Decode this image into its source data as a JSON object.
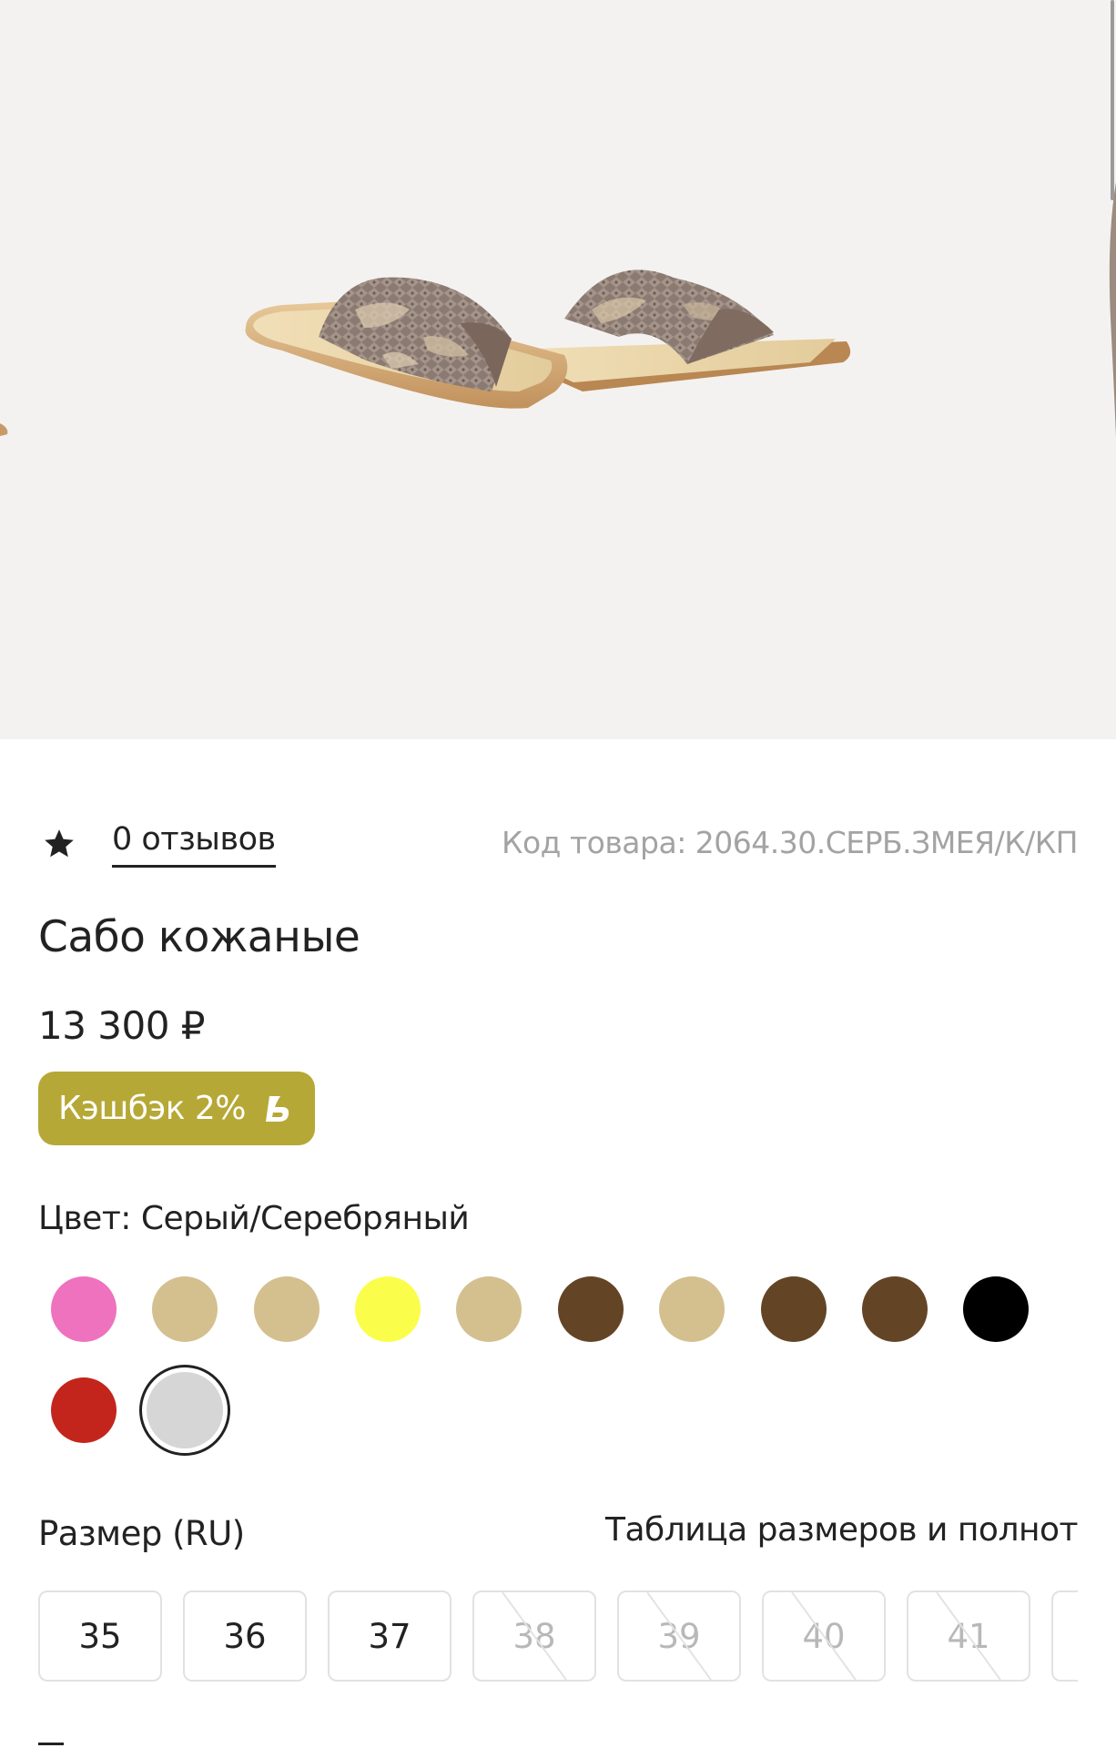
{
  "product": {
    "reviews_label": "0 отзывов",
    "sku_label": "Код товара: 2064.30.СЕРБ.ЗМЕЯ/К/КП",
    "title": "Сабо кожаные",
    "price": "13 300 ₽",
    "cashback_label": "Кэшбэк 2%",
    "color_label": "Цвет: Серый/Серебряный",
    "size_label": "Размер (RU)",
    "size_table_label": "Таблица размеров и полнот"
  },
  "colors": {
    "accent_cashback": "#b6a836",
    "swatches": [
      "#ee72be",
      "#d4c08f",
      "#d4c08f",
      "#fafe4a",
      "#d4c08f",
      "#634526",
      "#d4c08f",
      "#634526",
      "#634526",
      "#000000",
      "#c3251c",
      "#d6d6d6"
    ],
    "selected_swatch_index": 11
  },
  "sizes": [
    {
      "label": "35",
      "available": true
    },
    {
      "label": "36",
      "available": true
    },
    {
      "label": "37",
      "available": true
    },
    {
      "label": "38",
      "available": false
    },
    {
      "label": "39",
      "available": false
    },
    {
      "label": "40",
      "available": false
    },
    {
      "label": "41",
      "available": false
    }
  ],
  "icons": {
    "rating": "star-icon",
    "cashback": "cashback-logo-icon"
  }
}
